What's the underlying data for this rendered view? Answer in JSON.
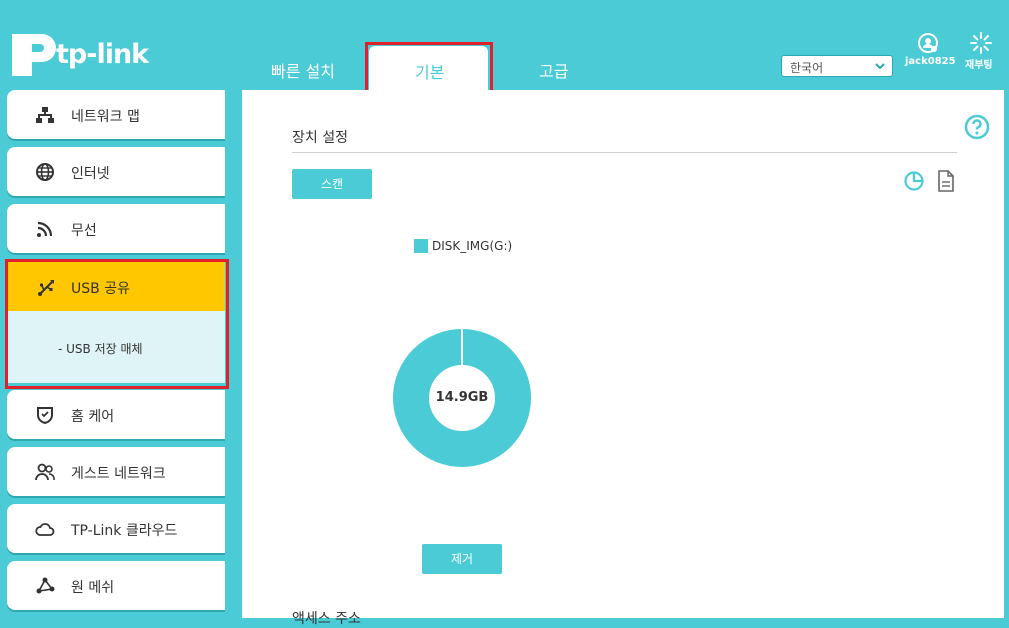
{
  "brand": {
    "name": "tp-link"
  },
  "tabs": {
    "quick": "빠른 설치",
    "basic": "기본",
    "advanced": "고급"
  },
  "language": {
    "selected": "한국어"
  },
  "user": {
    "name": "jack0825",
    "icon": "user-icon"
  },
  "reboot": {
    "label": "재부팅",
    "icon": "reboot-icon"
  },
  "sidebar": {
    "items": [
      {
        "label": "네트워크 맵",
        "icon": "network-map-icon"
      },
      {
        "label": "인터넷",
        "icon": "globe-icon"
      },
      {
        "label": "무선",
        "icon": "wireless-icon"
      },
      {
        "label": "USB 공유",
        "icon": "usb-icon"
      },
      {
        "label": "홈 케어",
        "icon": "shield-icon"
      },
      {
        "label": "게스트 네트워크",
        "icon": "guests-icon"
      },
      {
        "label": "TP-Link 클라우드",
        "icon": "cloud-icon"
      },
      {
        "label": "원 메쉬",
        "icon": "mesh-icon"
      }
    ],
    "usb_sub": "- USB 저장 매체"
  },
  "main": {
    "section_title": "장치 설정",
    "scan_button": "스캔",
    "remove_button": "제거",
    "access_title": "액세스 주소"
  },
  "chart_data": {
    "type": "pie",
    "series": [
      {
        "name": "DISK_IMG(G:)",
        "values": [
          14.9
        ]
      }
    ],
    "center_label": "14.9GB",
    "color": "#4acbd6"
  },
  "colors": {
    "accent": "#4acbd6",
    "active": "#ffc700",
    "highlight": "#e0202a"
  }
}
